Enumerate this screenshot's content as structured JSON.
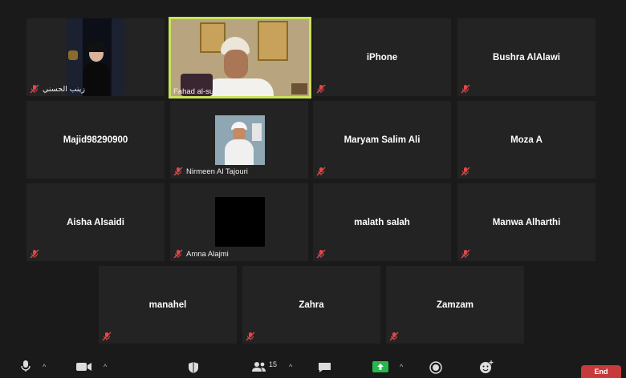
{
  "tiles": [
    {
      "name": "زينب الحسني",
      "video": true
    },
    {
      "name": "Fahad al-subhi",
      "video": true,
      "active": true
    },
    {
      "name": "iPhone"
    },
    {
      "name": "Bushra AlAlawi"
    },
    {
      "name": "Majid98290900"
    },
    {
      "name": "Nirmeen Al Tajouri",
      "video": true
    },
    {
      "name": "Maryam Salim Ali"
    },
    {
      "name": "Moza A"
    },
    {
      "name": "Aisha Alsaidi"
    },
    {
      "name": "Amna Alajmi",
      "video": true
    },
    {
      "name": "malath salah"
    },
    {
      "name": "Manwa Alharthi"
    },
    {
      "name": "manahel"
    },
    {
      "name": "Zahra"
    },
    {
      "name": "Zamzam"
    }
  ],
  "toolbar": {
    "participants_count": "15",
    "end_label": "End"
  },
  "colors": {
    "active_speaker": "#c9e35b",
    "muted_icon": "#e0484a",
    "share_green": "#27b84d",
    "end_red": "#c73a3a"
  },
  "icons": [
    "mic-icon",
    "video-icon",
    "security-shield-icon",
    "participants-icon",
    "chat-icon",
    "share-screen-icon",
    "record-icon",
    "reactions-icon"
  ]
}
